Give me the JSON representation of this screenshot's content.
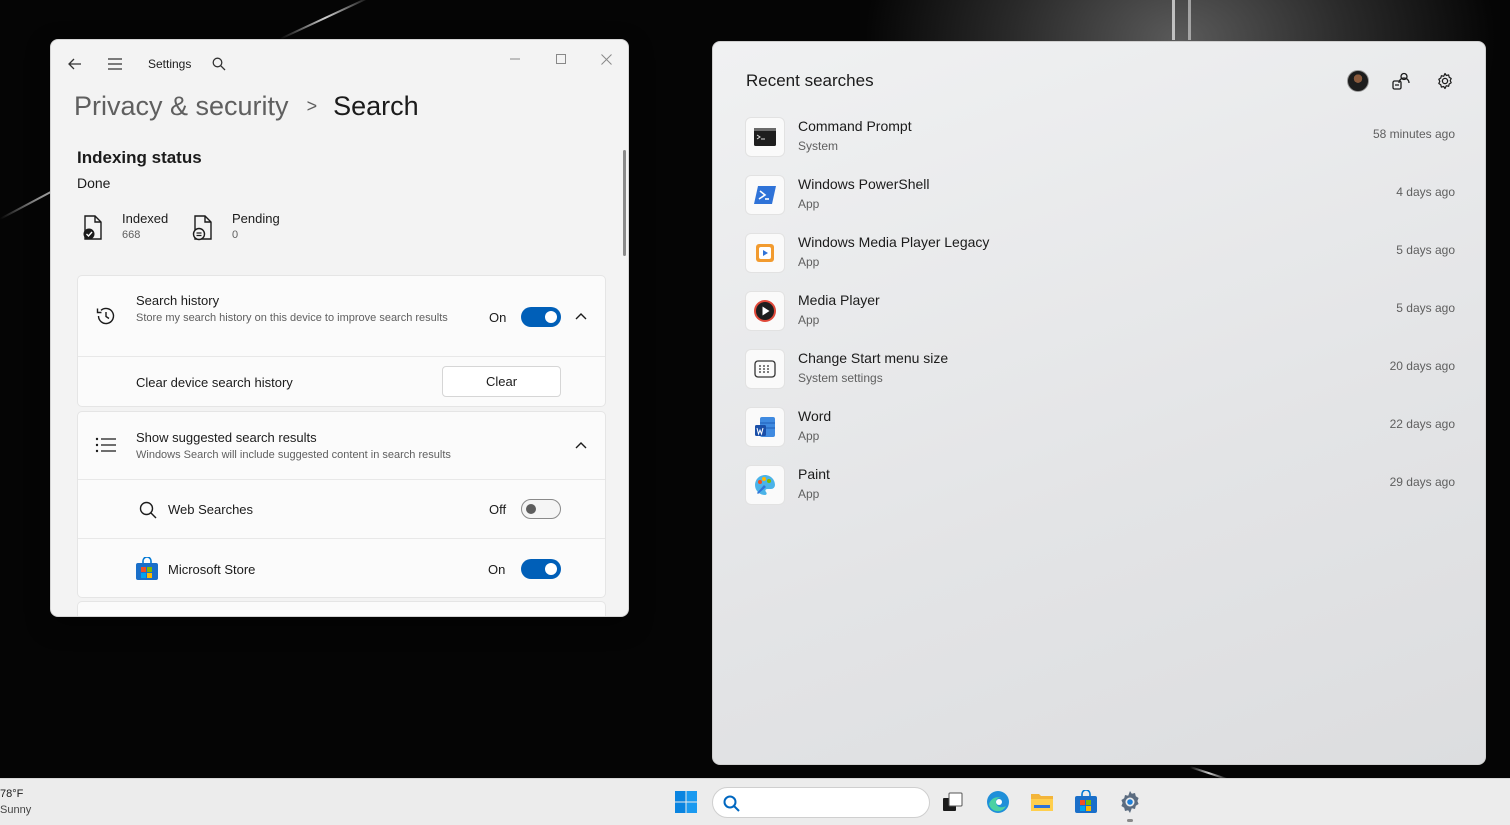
{
  "settings": {
    "app_title": "Settings",
    "breadcrumb": {
      "parent": "Privacy & security",
      "separator": ">",
      "current": "Search"
    },
    "indexing": {
      "title": "Indexing status",
      "status": "Done",
      "indexed_label": "Indexed",
      "indexed_value": "668",
      "pending_label": "Pending",
      "pending_value": "0"
    },
    "search_history": {
      "title": "Search history",
      "description": "Store my search history on this device to improve search results",
      "state": "On",
      "clear_label": "Clear device search history",
      "clear_button": "Clear"
    },
    "suggested": {
      "title": "Show suggested search results",
      "description": "Windows Search will include suggested content in search results",
      "web_label": "Web Searches",
      "web_state": "Off",
      "store_label": "Microsoft Store",
      "store_state": "On"
    }
  },
  "search_panel": {
    "title": "Recent searches",
    "results": [
      {
        "name": "Command Prompt",
        "type": "System",
        "time": "58 minutes ago",
        "icon": "command-prompt-icon"
      },
      {
        "name": "Windows PowerShell",
        "type": "App",
        "time": "4 days ago",
        "icon": "powershell-icon"
      },
      {
        "name": "Windows Media Player Legacy",
        "type": "App",
        "time": "5 days ago",
        "icon": "media-player-legacy-icon"
      },
      {
        "name": "Media Player",
        "type": "App",
        "time": "5 days ago",
        "icon": "media-player-icon"
      },
      {
        "name": "Change Start menu size",
        "type": "System settings",
        "time": "20 days ago",
        "icon": "start-menu-settings-icon"
      },
      {
        "name": "Word",
        "type": "App",
        "time": "22 days ago",
        "icon": "word-icon"
      },
      {
        "name": "Paint",
        "type": "App",
        "time": "29 days ago",
        "icon": "paint-icon"
      }
    ]
  },
  "taskbar": {
    "weather_temp": "78°F",
    "weather_condition": "Sunny"
  },
  "colors": {
    "accent": "#005fb8",
    "panel_bg": "#f3f3f3",
    "taskbar_bg": "#ececec"
  }
}
